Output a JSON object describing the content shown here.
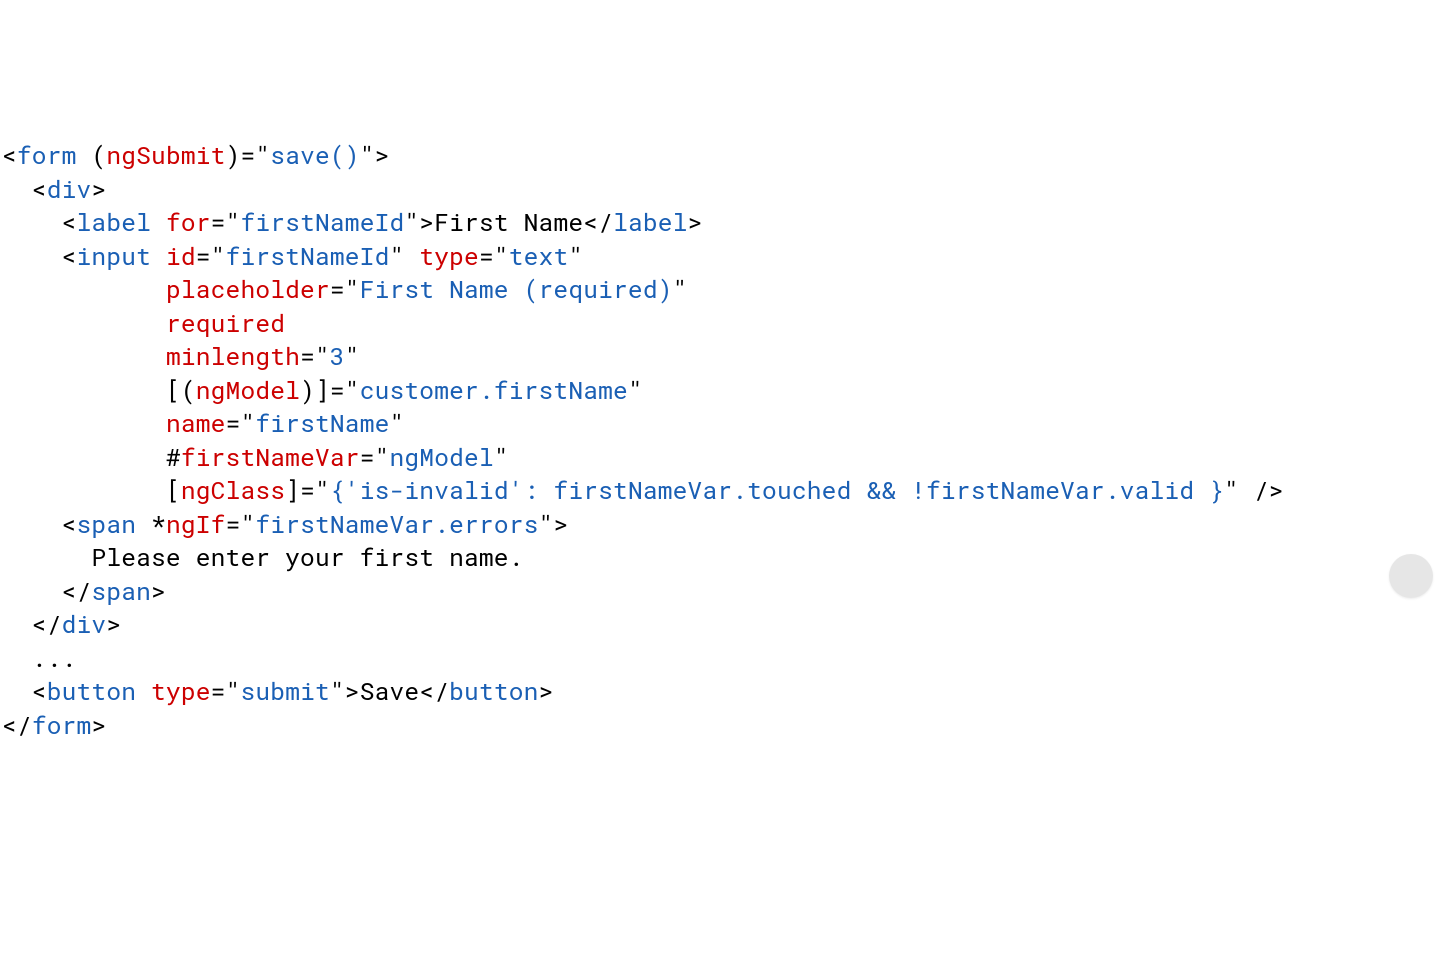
{
  "code": {
    "l1": {
      "a": "<",
      "b": "form",
      "c": " (",
      "d": "ngSubmit",
      "e": ")=\"",
      "f": "save()",
      "g": "\">"
    },
    "l2": {
      "a": "  <",
      "b": "div",
      "c": ">"
    },
    "l3": {
      "a": "    <",
      "b": "label",
      "c": " ",
      "d": "for",
      "e": "=\"",
      "f": "firstNameId",
      "g": "\">",
      "h": "First Name",
      "i": "</",
      "j": "label",
      "k": ">"
    },
    "l4": {
      "a": "    <",
      "b": "input",
      "c": " ",
      "d": "id",
      "e": "=\"",
      "f": "firstNameId",
      "g": "\" ",
      "h": "type",
      "i": "=\"",
      "j": "text",
      "k": "\""
    },
    "l5": {
      "a": "           ",
      "b": "placeholder",
      "c": "=\"",
      "d": "First Name (required)",
      "e": "\""
    },
    "l6": {
      "a": "           ",
      "b": "required"
    },
    "l7": {
      "a": "           ",
      "b": "minlength",
      "c": "=\"",
      "d": "3",
      "e": "\""
    },
    "l8": {
      "a": "           [(",
      "b": "ngModel",
      "c": ")]=\"",
      "d": "customer.firstName",
      "e": "\""
    },
    "l9": {
      "a": "           ",
      "b": "name",
      "c": "=\"",
      "d": "firstName",
      "e": "\""
    },
    "l10": {
      "a": "           #",
      "b": "firstNameVar",
      "c": "=\"",
      "d": "ngModel",
      "e": "\""
    },
    "l11": {
      "a": "           [",
      "b": "ngClass",
      "c": "]=\"",
      "d": "{'is-invalid': firstNameVar.touched && !firstNameVar.valid }",
      "e": "\" />"
    },
    "l12": {
      "a": "    <",
      "b": "span",
      "c": " *",
      "d": "ngIf",
      "e": "=\"",
      "f": "firstNameVar.errors",
      "g": "\">"
    },
    "l13": {
      "a": "      Please enter your first name."
    },
    "l14": {
      "a": "    </",
      "b": "span",
      "c": ">"
    },
    "l15": {
      "a": "  </",
      "b": "div",
      "c": ">"
    },
    "l16": {
      "a": "  ..."
    },
    "l17": {
      "a": "  <",
      "b": "button",
      "c": " ",
      "d": "type",
      "e": "=\"",
      "f": "submit",
      "g": "\">",
      "h": "Save",
      "i": "</",
      "j": "button",
      "k": ">"
    },
    "l18": {
      "a": "</",
      "b": "form",
      "c": ">"
    }
  }
}
